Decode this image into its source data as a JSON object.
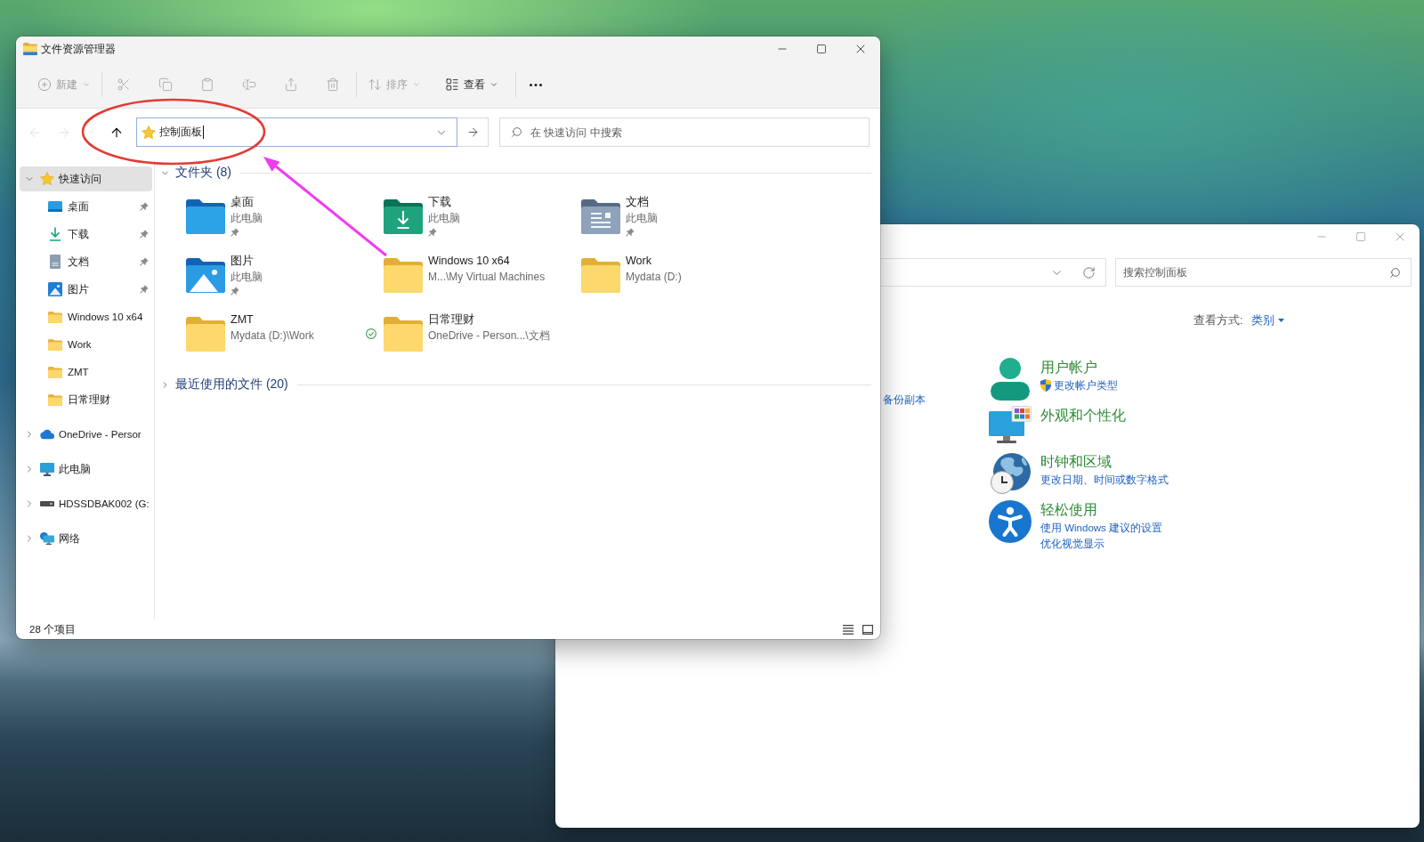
{
  "explorer_window": {
    "title": "文件资源管理器",
    "toolbar": {
      "new_menu": {
        "label": "新建",
        "disabled": true
      },
      "actions": [
        {
          "kind": "cut",
          "disabled": true
        },
        {
          "kind": "copy",
          "disabled": true
        },
        {
          "kind": "paste",
          "disabled": true
        },
        {
          "kind": "rename",
          "disabled": true
        },
        {
          "kind": "share",
          "disabled": true
        },
        {
          "kind": "delete",
          "disabled": true
        }
      ],
      "sort_menu": {
        "label": "排序",
        "disabled": true
      },
      "view_menu": {
        "label": "查看",
        "disabled": false
      }
    },
    "navigation": [
      {
        "kind": "back",
        "disabled": true
      },
      {
        "kind": "forward",
        "disabled": true
      },
      {
        "kind": "recent",
        "disabled": true
      },
      {
        "kind": "up",
        "disabled": false
      }
    ],
    "address_bar": {
      "value": "控制面板",
      "focused": true
    },
    "search": {
      "placeholder": "在 快速访问 中搜索"
    },
    "sidebar": {
      "items": [
        {
          "kind": "star",
          "label": "快速访问",
          "expanded": true,
          "selected": true,
          "children": [
            {
              "kind": "desktop",
              "label": "桌面",
              "pinned": true,
              "selected": false
            },
            {
              "kind": "download",
              "label": "下载",
              "pinned": true,
              "selected": false
            },
            {
              "kind": "document",
              "label": "文档",
              "pinned": true,
              "selected": false
            },
            {
              "kind": "pictures",
              "label": "图片",
              "pinned": true,
              "selected": false
            },
            {
              "kind": "folder",
              "label": "Windows 10 x64",
              "pinned": false,
              "selected": false
            },
            {
              "kind": "folder",
              "label": "Work",
              "pinned": false,
              "selected": false
            },
            {
              "kind": "folder",
              "label": "ZMT",
              "pinned": false,
              "selected": false
            },
            {
              "kind": "folder",
              "label": "日常理财",
              "pinned": false,
              "selected": false
            }
          ]
        },
        {
          "kind": "cloud",
          "label": "OneDrive - Persor",
          "expanded": false,
          "selected": false
        },
        {
          "kind": "computer",
          "label": "此电脑",
          "expanded": false,
          "selected": false
        },
        {
          "kind": "drive",
          "label": "HDSSDBAK002 (G:",
          "expanded": false,
          "selected": false
        },
        {
          "kind": "network",
          "label": "网络",
          "expanded": false,
          "selected": false
        }
      ]
    },
    "content": {
      "groups": [
        {
          "label": "文件夹 (8)",
          "expanded": true,
          "items": [
            {
              "kind": "desktop",
              "name": "桌面",
              "location": "此电脑",
              "pinned": true,
              "synced": false
            },
            {
              "kind": "download",
              "name": "下载",
              "location": "此电脑",
              "pinned": true,
              "synced": false
            },
            {
              "kind": "document",
              "name": "文档",
              "location": "此电脑",
              "pinned": true,
              "synced": false
            },
            {
              "kind": "pictures",
              "name": "图片",
              "location": "此电脑",
              "pinned": true,
              "synced": false
            },
            {
              "kind": "folder",
              "name": "Windows 10 x64",
              "location": "M...\\My Virtual Machines",
              "pinned": false,
              "synced": false
            },
            {
              "kind": "folder",
              "name": "Work",
              "location": "Mydata (D:)",
              "pinned": false,
              "synced": false
            },
            {
              "kind": "folder",
              "name": "ZMT",
              "location": "Mydata (D:)\\Work",
              "pinned": false,
              "synced": false
            },
            {
              "kind": "folder",
              "name": "日常理财",
              "location": "OneDrive - Person...\\文档",
              "pinned": false,
              "synced": true
            }
          ]
        },
        {
          "label": "最近使用的文件 (20)",
          "expanded": false
        }
      ]
    },
    "status_bar": {
      "item_count": "28 个项目"
    }
  },
  "control_panel_window": {
    "search": {
      "placeholder": "搜索控制面板"
    },
    "view_by": {
      "label": "查看方式:",
      "value": "类别"
    },
    "partial_link": "备份副本",
    "categories": [
      {
        "kind": "user",
        "title": "用户帐户",
        "links": [
          {
            "text": "更改帐户类型",
            "shield": true
          }
        ]
      },
      {
        "kind": "appearance",
        "title": "外观和个性化"
      },
      {
        "kind": "clock",
        "title": "时钟和区域",
        "links": [
          {
            "text": "更改日期、时间或数字格式",
            "shield": false
          }
        ]
      },
      {
        "kind": "accessibility",
        "title": "轻松使用",
        "links": [
          {
            "text": "使用 Windows 建议的设置",
            "shield": false
          },
          {
            "text": "优化视觉显示",
            "shield": false
          }
        ]
      }
    ]
  }
}
